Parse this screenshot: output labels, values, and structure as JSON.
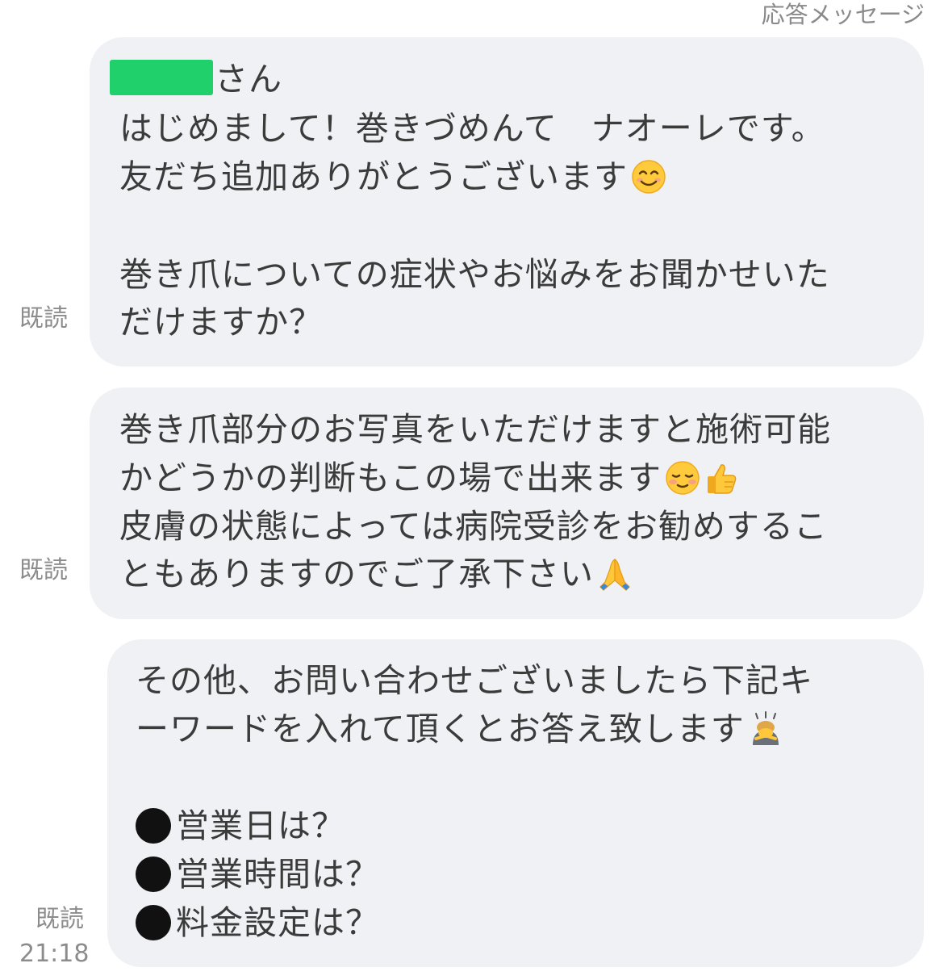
{
  "header": {
    "label": "応答メッセージ"
  },
  "messages": [
    {
      "status": "既読",
      "name_suffix": "さん",
      "lines": [
        "はじめまして！巻きづめんて　ナオーレです。",
        "友だち追加ありがとうございます",
        "巻き爪についての症状やお悩みをお聞かせいた",
        "だけますか？"
      ],
      "emojis": [
        "smiling-face-icon"
      ]
    },
    {
      "status": "既読",
      "lines": [
        "巻き爪部分のお写真をいただけますと施術可能",
        "かどうかの判断もこの場で出来ます",
        "皮膚の状態によっては病院受診をお勧めするこ",
        "ともありますのでご了承下さい"
      ],
      "emojis": [
        "relieved-face-icon",
        "thumbs-up-icon",
        "folded-hands-icon"
      ]
    },
    {
      "status": "既読",
      "time": "21:18",
      "lines": [
        "その他、お問い合わせございましたら下記キ",
        "ーワードを入れて頂くとお答え致します"
      ],
      "keywords": [
        "営業日は？",
        "営業時間は？",
        "料金設定は？"
      ],
      "emojis": [
        "bowing-person-icon",
        "black-circle-icon"
      ]
    }
  ],
  "colors": {
    "bubble": "#f0f1f4",
    "text": "#3b3b3b",
    "status": "#8c8c8c",
    "redaction": "#1fd06b"
  }
}
